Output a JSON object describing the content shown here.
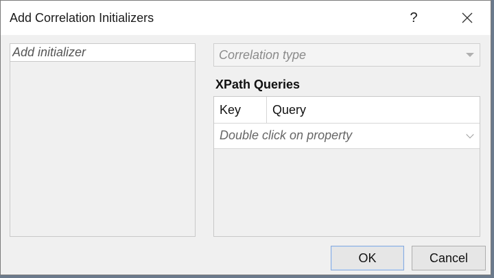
{
  "window": {
    "title": "Add Correlation Initializers",
    "help_label": "?"
  },
  "left_panel": {
    "placeholder": "Add initializer"
  },
  "correlation_type": {
    "placeholder": "Correlation type"
  },
  "xpath": {
    "heading": "XPath Queries",
    "columns": [
      "Key",
      "Query"
    ],
    "property_placeholder": "Double click on property"
  },
  "buttons": {
    "ok": "OK",
    "cancel": "Cancel"
  },
  "icons": {
    "close": "close-icon",
    "dropdown": "chevron-down-icon"
  }
}
